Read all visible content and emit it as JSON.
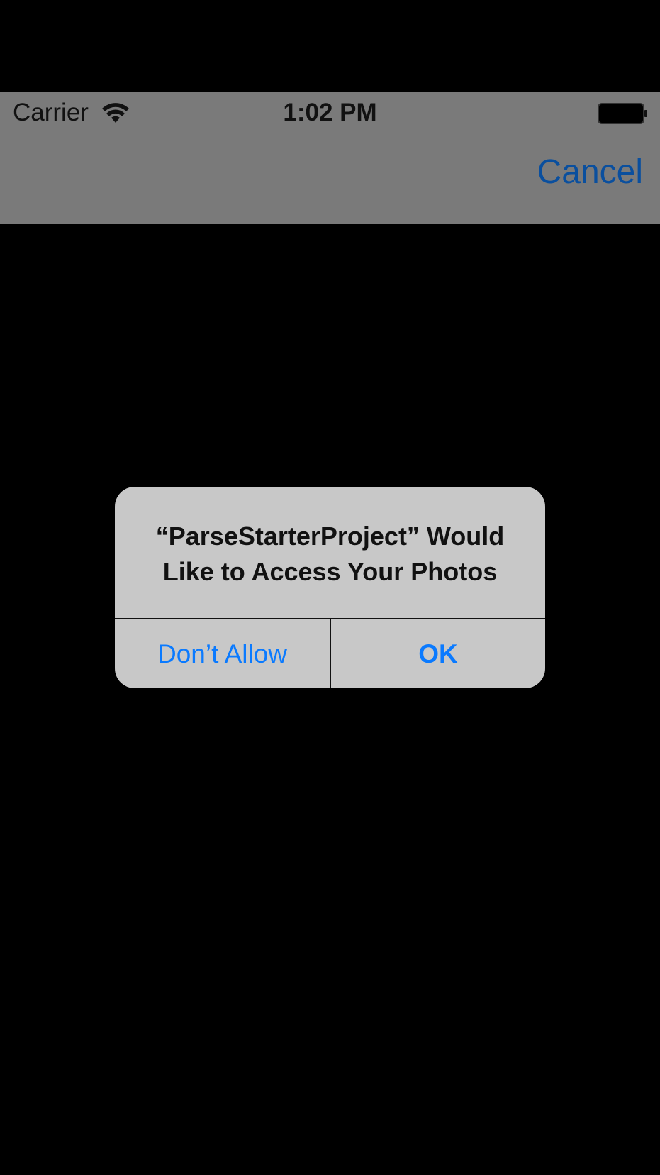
{
  "status_bar": {
    "carrier": "Carrier",
    "time": "1:02 PM",
    "wifi_icon": "wifi-icon",
    "battery_icon": "battery-icon"
  },
  "nav_bar": {
    "cancel_label": "Cancel"
  },
  "alert": {
    "title_line1": "“ParseStarterProject” Would",
    "title_line2": "Like to Access Your Photos",
    "dont_allow_label": "Don’t Allow",
    "ok_label": "OK"
  },
  "colors": {
    "header_background": "#7a7a7a",
    "accent": "#0a7aff",
    "alert_background": "#c8c8c8"
  }
}
